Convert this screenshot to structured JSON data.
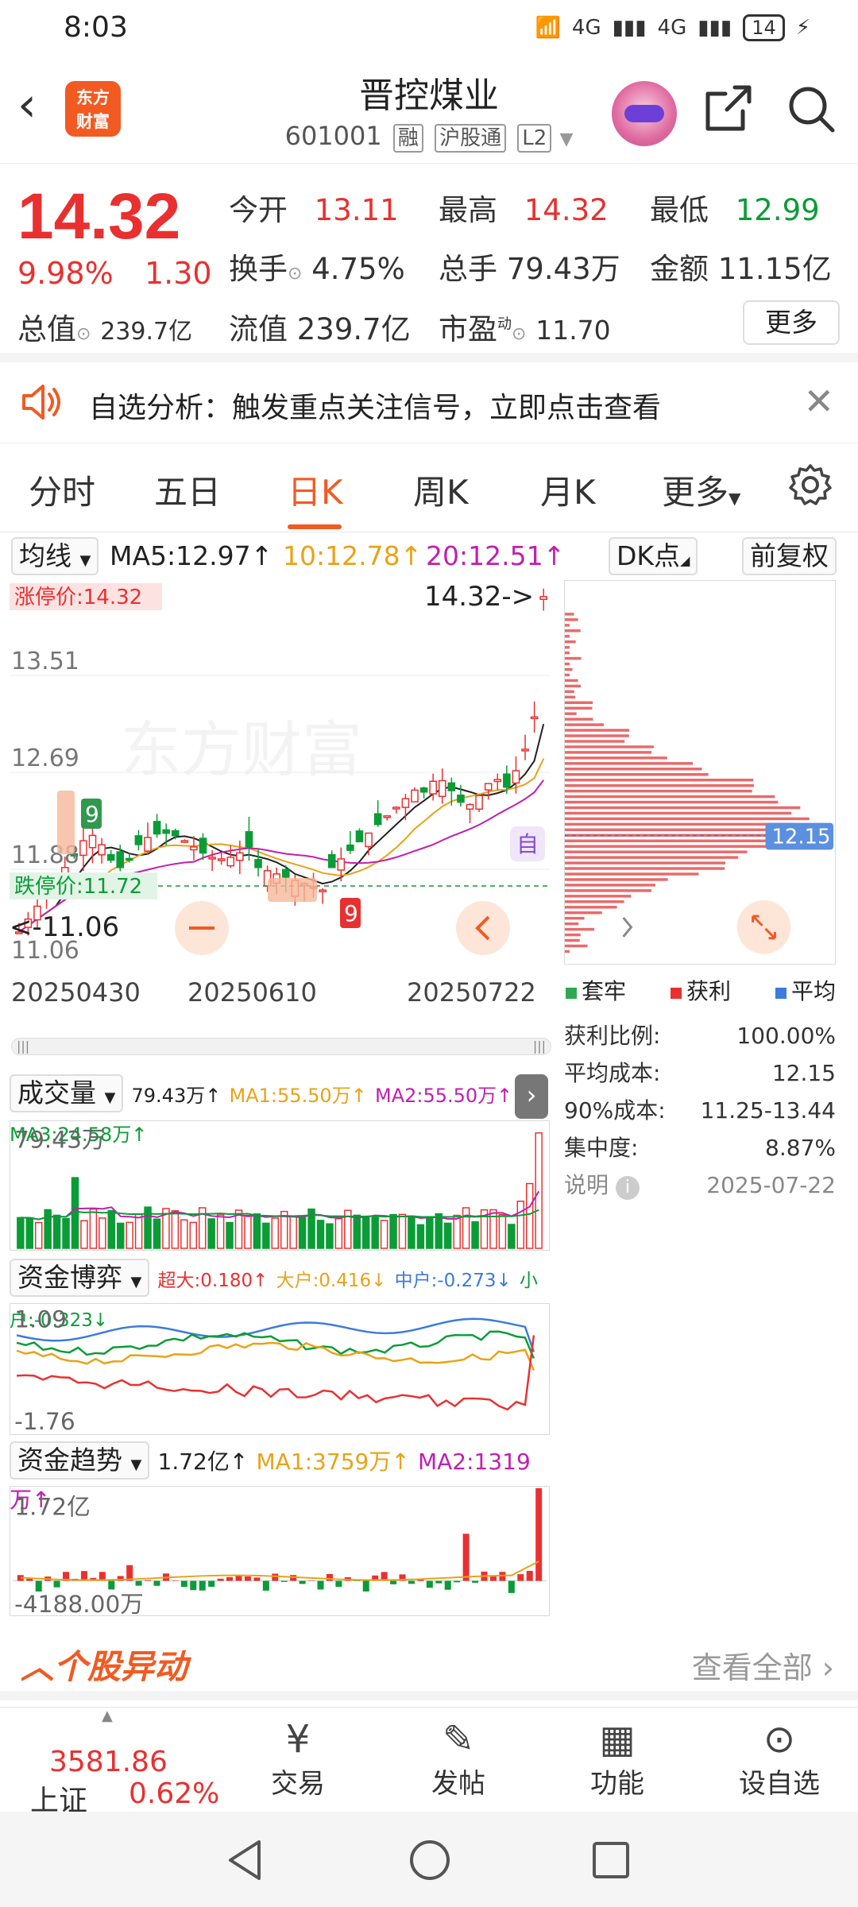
{
  "status_bar": {
    "time": "8:03",
    "network": "4G",
    "battery": "14"
  },
  "header": {
    "back_icon": "chevron-left",
    "logo_line1": "东方",
    "logo_line2": "财富",
    "title": "晋控煤业",
    "code": "601001",
    "tags": [
      "融",
      "沪股通",
      "L2"
    ]
  },
  "quote": {
    "price": "14.32",
    "change_pct": "9.98%",
    "change": "1.30",
    "open_label": "今开",
    "open": "13.11",
    "high_label": "最高",
    "high": "14.32",
    "low_label": "最低",
    "low": "12.99",
    "turnover_label": "换手",
    "turnover": "4.75%",
    "volume_label": "总手",
    "volume": "79.43万",
    "amount_label": "金额",
    "amount": "11.15亿",
    "mktcap_label": "总值",
    "mktcap": "239.7亿",
    "float_label": "流值",
    "float": "239.7亿",
    "pe_label": "市盈",
    "pe_sup": "动",
    "pe": "11.70",
    "more": "更多"
  },
  "notice": {
    "text": "自选分析：触发重点关注信号，立即点击查看"
  },
  "tabs": [
    "分时",
    "五日",
    "日K",
    "周K",
    "月K",
    "更多"
  ],
  "active_tab": "日K",
  "ma_bar": {
    "selector": "均线",
    "ma5": "MA5:12.97↑",
    "ma10": "10:12.78↑",
    "ma20": "20:12.51↑",
    "dk": "DK点",
    "fq": "前复权"
  },
  "main_chart": {
    "limit_up": "涨停价:14.32",
    "limit_down": "跌停价:11.72",
    "y_ticks": [
      "13.51",
      "12.69",
      "11.88",
      "11.06"
    ],
    "last_label": "14.32->",
    "low_label": "<-11.06",
    "dates": [
      "20250430",
      "20250610",
      "20250722"
    ],
    "self_tag": "自",
    "watermark": "东方财富"
  },
  "chip": {
    "avg_price_tag": "12.15",
    "legend": [
      "套牢",
      "获利",
      "平均"
    ],
    "rows": [
      {
        "k": "获利比例:",
        "v": "100.00%"
      },
      {
        "k": "平均成本:",
        "v": "12.15"
      },
      {
        "k": "90%成本:",
        "v": "11.25-13.44"
      },
      {
        "k": "集中度:",
        "v": "8.87%"
      }
    ],
    "note": "说明",
    "date": "2025-07-22"
  },
  "volume_panel": {
    "selector": "成交量",
    "v": "79.43万↑",
    "ma1": "MA1:55.50万↑",
    "ma2": "MA2:55.50万↑",
    "ma3": "MA3:24.58万↑",
    "top": "79.43万"
  },
  "fund_game": {
    "selector": "资金博弈",
    "big": "超大:0.180↑",
    "large": "大户:0.416↓",
    "mid": "中户:-0.273↓",
    "small": "小户:-0.323↓",
    "top": "1.09",
    "bottom": "-1.76"
  },
  "fund_trend": {
    "selector": "资金趋势",
    "v": "1.72亿↑",
    "ma1": "MA1:3759万↑",
    "ma2": "MA2:1319万↑",
    "top": "1.72亿",
    "bottom": "-4188.00万"
  },
  "alert_section": {
    "title": "个股异动",
    "view_all": "查看全部"
  },
  "bottom_nav": {
    "index_value": "3581.86",
    "index_name": "上证",
    "index_pct": "0.62%",
    "items": [
      "交易",
      "发帖",
      "功能",
      "设自选"
    ]
  },
  "colors": {
    "up": "#e93030",
    "down": "#0a9c36",
    "accent": "#f25a22",
    "ma5": "#222222",
    "ma10": "#e8a317",
    "ma20": "#c21fb0"
  }
}
